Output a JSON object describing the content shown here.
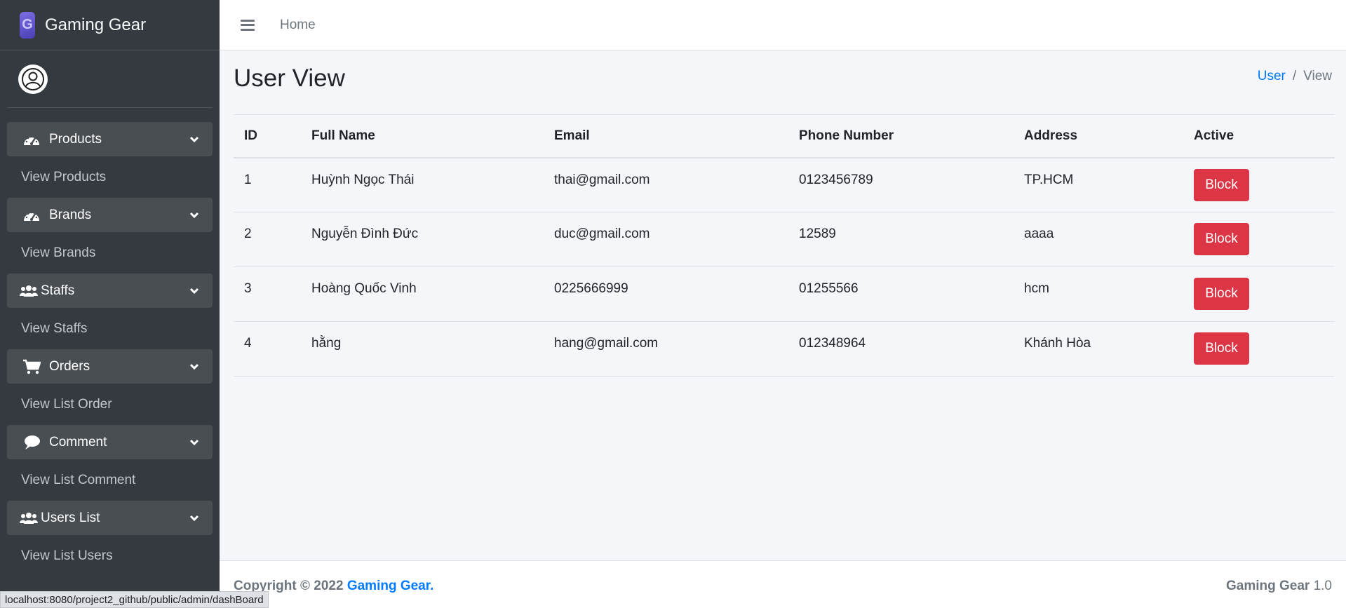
{
  "brand": {
    "name": "Gaming Gear",
    "logo_letter": "G"
  },
  "sidebar": {
    "groups": [
      {
        "label": "Products",
        "icon": "tachometer-icon",
        "sub": "View Products"
      },
      {
        "label": "Brands",
        "icon": "tachometer-icon",
        "sub": "View Brands"
      },
      {
        "label": "Staffs",
        "icon": "users-icon",
        "sub": "View Staffs"
      },
      {
        "label": "Orders",
        "icon": "cart-icon",
        "sub": "View List Order"
      },
      {
        "label": "Comment",
        "icon": "comment-icon",
        "sub": "View List Comment"
      },
      {
        "label": "Users List",
        "icon": "users-icon",
        "sub": "View List Users"
      }
    ]
  },
  "topbar": {
    "home": "Home"
  },
  "page": {
    "title": "User View"
  },
  "breadcrumb": {
    "link": "User",
    "separator": "/",
    "current": "View"
  },
  "table": {
    "headers": [
      "ID",
      "Full Name",
      "Email",
      "Phone Number",
      "Address",
      "Active"
    ],
    "rows": [
      {
        "id": "1",
        "name": "Huỳnh Ngọc Thái",
        "email": "thai@gmail.com",
        "phone": "0123456789",
        "address": "TP.HCM",
        "action": "Block"
      },
      {
        "id": "2",
        "name": "Nguyễn Đình Đức",
        "email": "duc@gmail.com",
        "phone": "12589",
        "address": "aaaa",
        "action": "Block"
      },
      {
        "id": "3",
        "name": "Hoàng Quốc Vinh",
        "email": "0225666999",
        "phone": "01255566",
        "address": "hcm",
        "action": "Block"
      },
      {
        "id": "4",
        "name": "hằng",
        "email": "hang@gmail.com",
        "phone": "012348964",
        "address": "Khánh Hòa",
        "action": "Block"
      }
    ]
  },
  "footer": {
    "copyright_prefix": "Copyright © 2022",
    "copyright_link": "Gaming Gear.",
    "version_name": "Gaming Gear",
    "version_number": "1.0"
  },
  "statusbar": {
    "url": "localhost:8080/project2_github/public/admin/dashBoard"
  },
  "colors": {
    "sidebar": "#343a40",
    "accent": "#007bff",
    "danger": "#dc3545"
  }
}
